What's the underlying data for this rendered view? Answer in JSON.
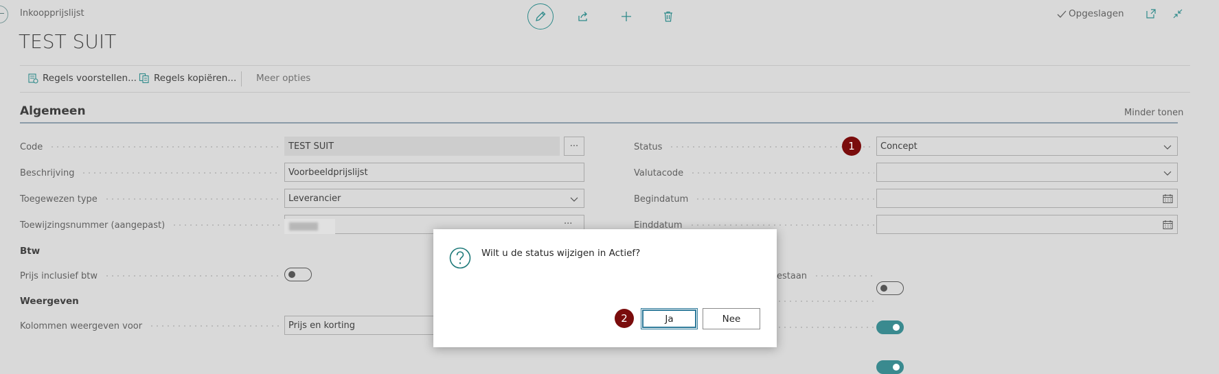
{
  "header": {
    "page_type": "Inkoopprijslijst",
    "title": "TEST SUIT",
    "saved_status": "Opgeslagen"
  },
  "actions": {
    "suggest_lines": "Regels voorstellen...",
    "copy_lines": "Regels kopiëren...",
    "more_options": "Meer opties"
  },
  "section": {
    "title": "Algemeen",
    "show_less": "Minder tonen"
  },
  "fields": {
    "code": {
      "label": "Code",
      "value": "TEST SUIT"
    },
    "description": {
      "label": "Beschrijving",
      "value": "Voorbeeldprijslijst"
    },
    "assign_type": {
      "label": "Toegewezen type",
      "value": "Leverancier"
    },
    "assign_no": {
      "label": "Toewijzingsnummer (aangepast)",
      "value": ""
    },
    "vat_group": "Btw",
    "price_incl_vat": {
      "label": "Prijs inclusief btw",
      "value": false
    },
    "display_group": "Weergeven",
    "columns_for": {
      "label": "Kolommen weergeven voor",
      "value": "Prijs en korting"
    },
    "status": {
      "label": "Status",
      "value": "Concept"
    },
    "currency": {
      "label": "Valutacode",
      "value": ""
    },
    "start_date": {
      "label": "Begindatum",
      "value": ""
    },
    "end_date": {
      "label": "Einddatum",
      "value": ""
    },
    "right_toggle_label_fragment": "estaan",
    "right_toggle_1": false,
    "right_toggle_2": true,
    "right_toggle_3": true
  },
  "callouts": {
    "one": "1",
    "two": "2"
  },
  "dialog": {
    "message": "Wilt u de status wijzigen in Actief?",
    "yes": "Ja",
    "no": "Nee"
  },
  "colors": {
    "accent": "#2e8a8a",
    "toggle_on": "#3a8a8f",
    "callout": "#7a0c0c",
    "overlay_bg": "#d9d9d9"
  }
}
